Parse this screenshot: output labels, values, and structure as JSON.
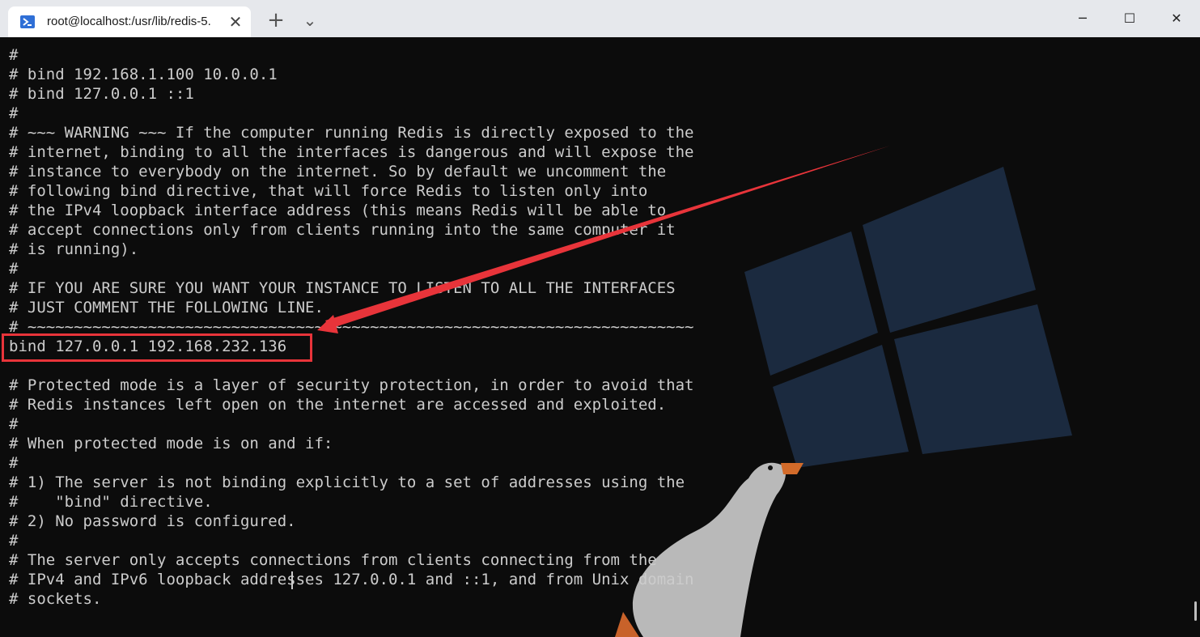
{
  "window": {
    "tab_title": "root@localhost:/usr/lib/redis-5.",
    "tab_icon": "powershell-icon",
    "close_tab_glyph": "✕",
    "new_tab_glyph": "+",
    "dropdown_glyph": "⌄",
    "minimize_glyph": "─",
    "maximize_glyph": "☐",
    "close_glyph": "✕"
  },
  "terminal": {
    "lines": [
      "#",
      "# bind 192.168.1.100 10.0.0.1",
      "# bind 127.0.0.1 ::1",
      "#",
      "# ~~~ WARNING ~~~ If the computer running Redis is directly exposed to the",
      "# internet, binding to all the interfaces is dangerous and will expose the",
      "# instance to everybody on the internet. So by default we uncomment the",
      "# following bind directive, that will force Redis to listen only into",
      "# the IPv4 loopback interface address (this means Redis will be able to",
      "# accept connections only from clients running into the same computer it",
      "# is running).",
      "#",
      "# IF YOU ARE SURE YOU WANT YOUR INSTANCE TO LISTEN TO ALL THE INTERFACES",
      "# JUST COMMENT THE FOLLOWING LINE.",
      "# ~~~~~~~~~~~~~~~~~~~~~~~~~~~~~~~~~~~~~~~~~~~~~~~~~~~~~~~~~~~~~~~~~~~~~~~~",
      "bind 127.0.0.1 192.168.232.136",
      "",
      "# Protected mode is a layer of security protection, in order to avoid that",
      "# Redis instances left open on the internet are accessed and exploited.",
      "#",
      "# When protected mode is on and if:",
      "#",
      "# 1) The server is not binding explicitly to a set of addresses using the",
      "#    \"bind\" directive.",
      "# 2) No password is configured.",
      "#",
      "# The server only accepts connections from clients connecting from the",
      "# IPv4 and IPv6 loopback addresses 127.0.0.1 and ::1, and from Unix domain",
      "# sockets."
    ]
  },
  "annotation": {
    "highlight_color": "#e8343a"
  },
  "colors": {
    "terminal_bg": "#0c0c0c",
    "terminal_fg": "#cccccc",
    "titlebar_bg": "#e6e8ec",
    "windows_logo": "#1b2a3f"
  }
}
